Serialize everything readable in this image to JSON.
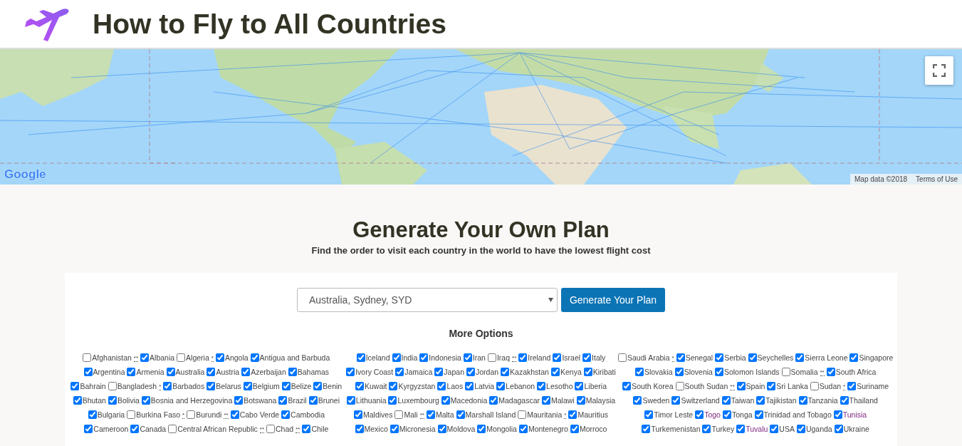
{
  "header": {
    "title": "How to Fly to All Countries"
  },
  "map": {
    "logo": "Google",
    "attribution": "Map data ©2018",
    "terms": "Terms of Use"
  },
  "plan": {
    "title": "Generate Your Own Plan",
    "subtitle": "Find the order to visit each country in the world to have the lowest flight cost",
    "origin_select": {
      "value": "Australia, Sydney, SYD"
    },
    "button": "Generate Your Plan",
    "more_options": "More Options"
  },
  "country_columns": [
    {
      "rows": [
        [
          {
            "name": "Afghanistan",
            "checked": false,
            "visited": false,
            "note": "**"
          },
          {
            "name": "Albania",
            "checked": true,
            "visited": false
          },
          {
            "name": "Algeria",
            "checked": false,
            "visited": false,
            "note": "*"
          },
          {
            "name": "Angola",
            "checked": true,
            "visited": false
          },
          {
            "name": "Antigua and Barbuda",
            "checked": true,
            "visited": false
          }
        ],
        [
          {
            "name": "Argentina",
            "checked": true,
            "visited": false
          },
          {
            "name": "Armenia",
            "checked": true,
            "visited": false
          },
          {
            "name": "Australia",
            "checked": true,
            "visited": false
          },
          {
            "name": "Austria",
            "checked": true,
            "visited": false
          },
          {
            "name": "Azerbaijan",
            "checked": true,
            "visited": false
          },
          {
            "name": "Bahamas",
            "checked": true,
            "visited": false
          }
        ],
        [
          {
            "name": "Bahrain",
            "checked": true,
            "visited": false
          },
          {
            "name": "Bangladesh",
            "checked": false,
            "visited": false,
            "note": "*"
          },
          {
            "name": "Barbados",
            "checked": true,
            "visited": false
          },
          {
            "name": "Belarus",
            "checked": true,
            "visited": false
          },
          {
            "name": "Belgium",
            "checked": true,
            "visited": false
          },
          {
            "name": "Belize",
            "checked": true,
            "visited": false
          },
          {
            "name": "Benin",
            "checked": true,
            "visited": false
          }
        ],
        [
          {
            "name": "Bhutan",
            "checked": true,
            "visited": false
          },
          {
            "name": "Bolivia",
            "checked": true,
            "visited": false
          },
          {
            "name": "Bosnia and Herzegovina",
            "checked": true,
            "visited": false
          },
          {
            "name": "Botswana",
            "checked": true,
            "visited": false
          },
          {
            "name": "Brazil",
            "checked": true,
            "visited": false
          },
          {
            "name": "Brunei",
            "checked": true,
            "visited": false
          }
        ],
        [
          {
            "name": "Bulgaria",
            "checked": true,
            "visited": false
          },
          {
            "name": "Burkina Faso",
            "checked": false,
            "visited": false,
            "note": "*"
          },
          {
            "name": "Burundi",
            "checked": false,
            "visited": false,
            "note": "**"
          },
          {
            "name": "Cabo Verde",
            "checked": true,
            "visited": false
          },
          {
            "name": "Cambodia",
            "checked": true,
            "visited": false
          }
        ],
        [
          {
            "name": "Cameroon",
            "checked": true,
            "visited": false
          },
          {
            "name": "Canada",
            "checked": true,
            "visited": false
          },
          {
            "name": "Central African Republic",
            "checked": false,
            "visited": false,
            "note": "**"
          },
          {
            "name": "Chad",
            "checked": false,
            "visited": false,
            "note": "**"
          },
          {
            "name": "Chile",
            "checked": true,
            "visited": false
          }
        ]
      ]
    },
    {
      "rows": [
        [
          {
            "name": "Iceland",
            "checked": true,
            "visited": false
          },
          {
            "name": "India",
            "checked": true,
            "visited": false
          },
          {
            "name": "Indonesia",
            "checked": true,
            "visited": false
          },
          {
            "name": "Iran",
            "checked": true,
            "visited": false
          },
          {
            "name": "Iraq",
            "checked": false,
            "visited": false,
            "note": "**"
          },
          {
            "name": "Ireland",
            "checked": true,
            "visited": false
          },
          {
            "name": "Israel",
            "checked": true,
            "visited": false
          },
          {
            "name": "Italy",
            "checked": true,
            "visited": false
          }
        ],
        [
          {
            "name": "Ivory Coast",
            "checked": true,
            "visited": false
          },
          {
            "name": "Jamaica",
            "checked": true,
            "visited": false
          },
          {
            "name": "Japan",
            "checked": true,
            "visited": false
          },
          {
            "name": "Jordan",
            "checked": true,
            "visited": false
          },
          {
            "name": "Kazakhstan",
            "checked": true,
            "visited": false
          },
          {
            "name": "Kenya",
            "checked": true,
            "visited": false
          },
          {
            "name": "Kiribati",
            "checked": true,
            "visited": false
          }
        ],
        [
          {
            "name": "Kuwait",
            "checked": true,
            "visited": false
          },
          {
            "name": "Kyrgyzstan",
            "checked": true,
            "visited": false
          },
          {
            "name": "Laos",
            "checked": true,
            "visited": false
          },
          {
            "name": "Latvia",
            "checked": true,
            "visited": false
          },
          {
            "name": "Lebanon",
            "checked": true,
            "visited": false
          },
          {
            "name": "Lesotho",
            "checked": true,
            "visited": false
          },
          {
            "name": "Liberia",
            "checked": true,
            "visited": false
          }
        ],
        [
          {
            "name": "Lithuania",
            "checked": true,
            "visited": false
          },
          {
            "name": "Luxembourg",
            "checked": true,
            "visited": false
          },
          {
            "name": "Macedonia",
            "checked": true,
            "visited": false
          },
          {
            "name": "Madagascar",
            "checked": true,
            "visited": false
          },
          {
            "name": "Malawi",
            "checked": true,
            "visited": false
          },
          {
            "name": "Malaysia",
            "checked": true,
            "visited": false
          }
        ],
        [
          {
            "name": "Maldives",
            "checked": true,
            "visited": false
          },
          {
            "name": "Mali",
            "checked": false,
            "visited": false,
            "note": "**"
          },
          {
            "name": "Malta",
            "checked": true,
            "visited": false
          },
          {
            "name": "Marshall Island",
            "checked": true,
            "visited": false
          },
          {
            "name": "Mauritania",
            "checked": false,
            "visited": false,
            "note": "*"
          },
          {
            "name": "Mauritius",
            "checked": true,
            "visited": false
          }
        ],
        [
          {
            "name": "Mexico",
            "checked": true,
            "visited": false
          },
          {
            "name": "Micronesia",
            "checked": true,
            "visited": false
          },
          {
            "name": "Moldova",
            "checked": true,
            "visited": false
          },
          {
            "name": "Mongolia",
            "checked": true,
            "visited": false
          },
          {
            "name": "Montenegro",
            "checked": true,
            "visited": false
          },
          {
            "name": "Morroco",
            "checked": true,
            "visited": false
          }
        ]
      ]
    },
    {
      "rows": [
        [
          {
            "name": "Saudi Arabia",
            "checked": false,
            "visited": false,
            "note": "*"
          },
          {
            "name": "Senegal",
            "checked": true,
            "visited": false
          },
          {
            "name": "Serbia",
            "checked": true,
            "visited": false
          },
          {
            "name": "Seychelles",
            "checked": true,
            "visited": false
          },
          {
            "name": "Sierra Leone",
            "checked": true,
            "visited": false
          },
          {
            "name": "Singapore",
            "checked": true,
            "visited": false
          }
        ],
        [
          {
            "name": "Slovakia",
            "checked": true,
            "visited": false
          },
          {
            "name": "Slovenia",
            "checked": true,
            "visited": false
          },
          {
            "name": "Solomon Islands",
            "checked": true,
            "visited": false
          },
          {
            "name": "Somalia",
            "checked": false,
            "visited": false,
            "note": "**"
          },
          {
            "name": "South Africa",
            "checked": true,
            "visited": false
          }
        ],
        [
          {
            "name": "South Korea",
            "checked": true,
            "visited": false
          },
          {
            "name": "South Sudan",
            "checked": false,
            "visited": false,
            "note": "**"
          },
          {
            "name": "Spain",
            "checked": true,
            "visited": false
          },
          {
            "name": "Sri Lanka",
            "checked": true,
            "visited": false
          },
          {
            "name": "Sudan",
            "checked": false,
            "visited": false,
            "note": "*"
          },
          {
            "name": "Suriname",
            "checked": true,
            "visited": false
          }
        ],
        [
          {
            "name": "Sweden",
            "checked": true,
            "visited": false
          },
          {
            "name": "Switzerland",
            "checked": true,
            "visited": false
          },
          {
            "name": "Taiwan",
            "checked": true,
            "visited": false
          },
          {
            "name": "Tajikistan",
            "checked": true,
            "visited": false
          },
          {
            "name": "Tanzania",
            "checked": true,
            "visited": false
          },
          {
            "name": "Thailand",
            "checked": true,
            "visited": false
          }
        ],
        [
          {
            "name": "Timor Leste",
            "checked": true,
            "visited": false
          },
          {
            "name": "Togo",
            "checked": true,
            "visited": true
          },
          {
            "name": "Tonga",
            "checked": true,
            "visited": false
          },
          {
            "name": "Trinidad and Tobago",
            "checked": true,
            "visited": false
          },
          {
            "name": "Tunisia",
            "checked": true,
            "visited": true
          }
        ],
        [
          {
            "name": "Turkemenistan",
            "checked": true,
            "visited": false
          },
          {
            "name": "Turkey",
            "checked": true,
            "visited": false
          },
          {
            "name": "Tuvalu",
            "checked": true,
            "visited": true
          },
          {
            "name": "USA",
            "checked": true,
            "visited": false
          },
          {
            "name": "Uganda",
            "checked": true,
            "visited": false
          },
          {
            "name": "Ukraine",
            "checked": true,
            "visited": false
          }
        ]
      ]
    }
  ]
}
